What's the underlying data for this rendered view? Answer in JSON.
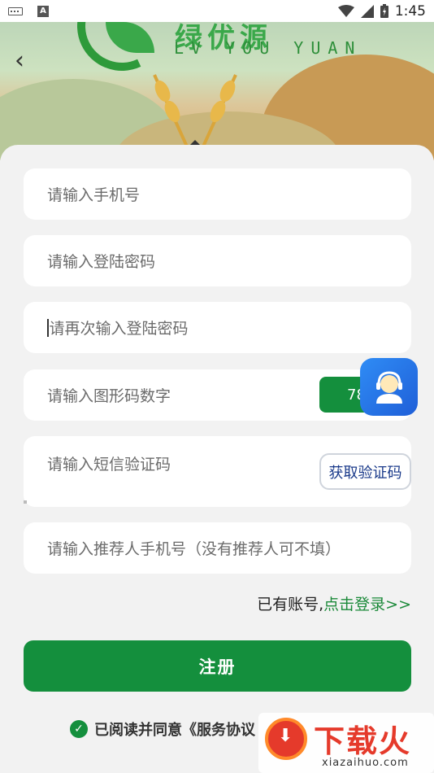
{
  "status_bar": {
    "time": "1:45",
    "notification_icon": "A"
  },
  "banner": {
    "logo_cn": "绿优源",
    "logo_en": "LV YOU YUAN"
  },
  "form": {
    "phone_placeholder": "请输入手机号",
    "password_placeholder": "请输入登陆密码",
    "confirm_password_placeholder": "请再次输入登陆密码",
    "captcha_placeholder": "请输入图形码数字",
    "captcha_value": "78",
    "sms_placeholder": "请输入短信验证码",
    "sms_button": "获取验证码",
    "referrer_placeholder": "请输入推荐人手机号（没有推荐人可不填）"
  },
  "login_prompt": {
    "text": "已有账号,",
    "link": "点击登录>>"
  },
  "register_button": "注册",
  "agreement": {
    "text": "已阅读并同意《服务协议"
  },
  "watermark": {
    "text": "下载火",
    "url": "xiazaihuo.com"
  },
  "colors": {
    "primary": "#148f3d",
    "link": "#1c8a3a",
    "float_button": "#2f8cf5"
  },
  "icons": [
    "keyboard-icon",
    "a-notification-icon",
    "wifi-icon",
    "signal-icon",
    "battery-icon",
    "back-chevron-icon",
    "check-circle-icon",
    "customer-service-icon"
  ]
}
